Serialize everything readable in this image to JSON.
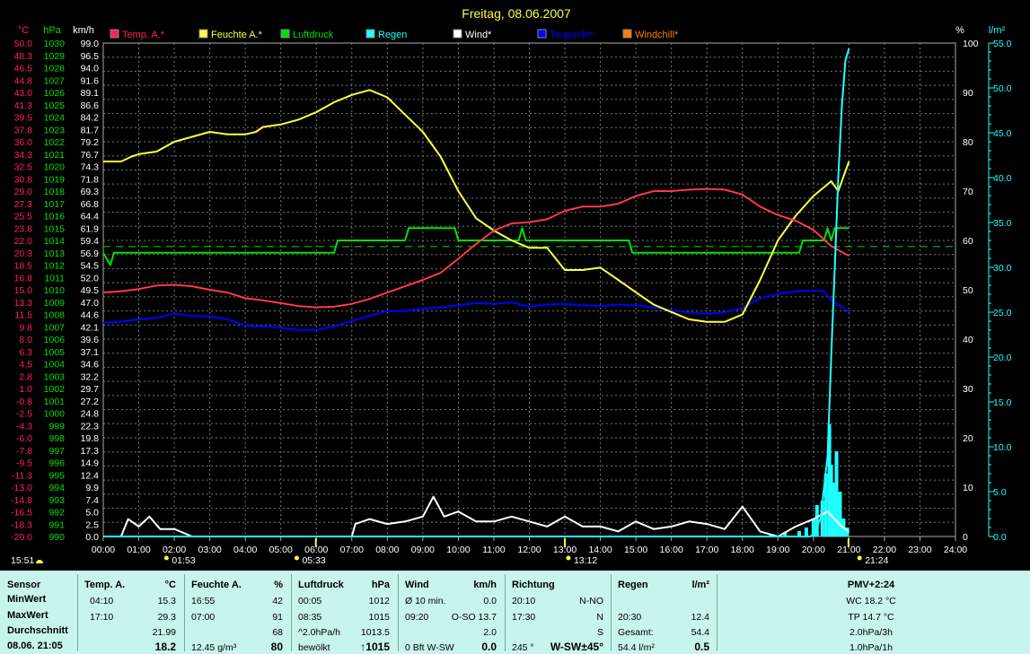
{
  "title": "Freitag, 08.06.2007",
  "colors": {
    "temp": "#ff2060",
    "humidity": "#ffff40",
    "pressure": "#00e000",
    "rain": "#20ffff",
    "wind": "#ffffff",
    "dewpoint": "#0000ff",
    "windchill": "#ff8000",
    "grid": "#777777",
    "axis_temp": "#ff2060",
    "axis_hpa": "#00e000",
    "axis_kmh": "#ffffff",
    "axis_rain": "#20ffff",
    "panel_bg": "#c8f4ee"
  },
  "axis_units": {
    "temp": "°C",
    "hpa": "hPa",
    "kmh": "km/h",
    "pct": "%",
    "rain": "l/m²"
  },
  "legend": [
    "Temp. A.*",
    "Feuchte A.*",
    "Luftdruck",
    "Regen",
    "Wind*",
    "Taupunkt*",
    "Windchill*"
  ],
  "time_labels": [
    "00:00",
    "01:00",
    "02:00",
    "03:00",
    "04:00",
    "05:00",
    "06:00",
    "07:00",
    "08:00",
    "09:00",
    "10:00",
    "11:00",
    "12:00",
    "13:00",
    "14:00",
    "15:00",
    "16:00",
    "17:00",
    "18:00",
    "19:00",
    "20:00",
    "21:00",
    "22:00",
    "23:00",
    "24:00"
  ],
  "events": [
    {
      "label": "01:53",
      "hour": 1.88
    },
    {
      "label": "05:33",
      "hour": 5.55
    },
    {
      "label": "13:12",
      "hour": 13.2
    },
    {
      "label": "21:24",
      "hour": 21.4
    }
  ],
  "current_time": "15:51",
  "chart_data": {
    "type": "line",
    "x_unit": "hour of day",
    "xlim": [
      0,
      24
    ],
    "axes": {
      "temp_c": [
        -20,
        50
      ],
      "pressure_hpa": [
        990,
        1030
      ],
      "wind_kmh": [
        0,
        99
      ],
      "humidity_pct": [
        0,
        100
      ],
      "rain_lm2": [
        0,
        55
      ]
    },
    "series": [
      {
        "name": "Temp. A.*",
        "axis": "temp_c",
        "points": [
          [
            0,
            14.6
          ],
          [
            0.5,
            14.8
          ],
          [
            1,
            15.1
          ],
          [
            1.5,
            15.6
          ],
          [
            2,
            15.7
          ],
          [
            2.5,
            15.5
          ],
          [
            3,
            15
          ],
          [
            3.5,
            14.6
          ],
          [
            4,
            13.8
          ],
          [
            4.5,
            13.5
          ],
          [
            5,
            13.1
          ],
          [
            5.5,
            12.7
          ],
          [
            6,
            12.5
          ],
          [
            6.5,
            12.6
          ],
          [
            7,
            13
          ],
          [
            7.5,
            13.7
          ],
          [
            8,
            14.6
          ],
          [
            8.5,
            15.5
          ],
          [
            9,
            16.4
          ],
          [
            9.5,
            17.4
          ],
          [
            10,
            19.4
          ],
          [
            10.5,
            21.5
          ],
          [
            11,
            23.4
          ],
          [
            11.5,
            24.4
          ],
          [
            12,
            24.6
          ],
          [
            12.5,
            25
          ],
          [
            13,
            26.2
          ],
          [
            13.5,
            26.8
          ],
          [
            14,
            26.8
          ],
          [
            14.5,
            27.2
          ],
          [
            15,
            28.3
          ],
          [
            15.5,
            29
          ],
          [
            16,
            29
          ],
          [
            16.5,
            29.2
          ],
          [
            17,
            29.3
          ],
          [
            17.5,
            29.2
          ],
          [
            18,
            28.5
          ],
          [
            18.5,
            26.8
          ],
          [
            19,
            25.6
          ],
          [
            19.5,
            24.8
          ],
          [
            20,
            23.5
          ],
          [
            20.5,
            21.2
          ],
          [
            21,
            19.8
          ]
        ]
      },
      {
        "name": "Feuchte A.*",
        "axis": "humidity_pct",
        "points": [
          [
            0,
            76
          ],
          [
            0.5,
            76
          ],
          [
            0.8,
            77
          ],
          [
            1,
            77.5
          ],
          [
            1.5,
            78
          ],
          [
            2,
            80
          ],
          [
            2.5,
            81
          ],
          [
            3,
            82
          ],
          [
            3.5,
            81.5
          ],
          [
            4,
            81.5
          ],
          [
            4.3,
            82
          ],
          [
            4.5,
            83
          ],
          [
            5,
            83.5
          ],
          [
            5.5,
            84.5
          ],
          [
            6,
            86
          ],
          [
            6.5,
            88
          ],
          [
            7,
            89.5
          ],
          [
            7.5,
            90.5
          ],
          [
            8,
            89
          ],
          [
            8.5,
            85.5
          ],
          [
            9,
            82
          ],
          [
            9.5,
            77
          ],
          [
            10,
            70
          ],
          [
            10.5,
            64.5
          ],
          [
            11,
            62
          ],
          [
            11.5,
            60
          ],
          [
            12,
            58.5
          ],
          [
            12.5,
            58.5
          ],
          [
            13,
            54
          ],
          [
            13.5,
            54
          ],
          [
            14,
            54.5
          ],
          [
            14.5,
            52
          ],
          [
            15,
            49.5
          ],
          [
            15.5,
            47
          ],
          [
            16,
            45.5
          ],
          [
            16.5,
            44
          ],
          [
            17,
            43.5
          ],
          [
            17.5,
            43.5
          ],
          [
            18,
            45
          ],
          [
            18.5,
            52
          ],
          [
            19,
            60
          ],
          [
            19.5,
            65
          ],
          [
            20,
            69
          ],
          [
            20.5,
            72
          ],
          [
            20.7,
            70
          ],
          [
            21,
            76
          ]
        ]
      },
      {
        "name": "Luftdruck",
        "axis": "pressure_hpa",
        "points": [
          [
            0,
            1013
          ],
          [
            0.2,
            1012
          ],
          [
            0.3,
            1013
          ],
          [
            1,
            1013
          ],
          [
            2,
            1013
          ],
          [
            3,
            1013
          ],
          [
            4,
            1013
          ],
          [
            5,
            1013
          ],
          [
            6,
            1013
          ],
          [
            6.5,
            1013
          ],
          [
            6.6,
            1014
          ],
          [
            7,
            1014
          ],
          [
            8,
            1014
          ],
          [
            8.5,
            1014
          ],
          [
            8.6,
            1015
          ],
          [
            9,
            1015
          ],
          [
            9.9,
            1015
          ],
          [
            10,
            1014
          ],
          [
            11,
            1014
          ],
          [
            11.7,
            1014
          ],
          [
            11.8,
            1015
          ],
          [
            11.9,
            1014
          ],
          [
            12,
            1014
          ],
          [
            13,
            1014
          ],
          [
            14,
            1014
          ],
          [
            14.8,
            1014
          ],
          [
            14.9,
            1013
          ],
          [
            16,
            1013
          ],
          [
            17,
            1013
          ],
          [
            18,
            1013
          ],
          [
            19,
            1013
          ],
          [
            19.6,
            1013
          ],
          [
            19.7,
            1014
          ],
          [
            20.3,
            1014
          ],
          [
            20.4,
            1015
          ],
          [
            20.5,
            1014
          ],
          [
            20.6,
            1015
          ],
          [
            21,
            1015
          ]
        ]
      },
      {
        "name": "Wind*",
        "axis": "wind_kmh",
        "points": [
          [
            0,
            0
          ],
          [
            0.5,
            0
          ],
          [
            0.7,
            3.5
          ],
          [
            1,
            2
          ],
          [
            1.3,
            4
          ],
          [
            1.6,
            1.5
          ],
          [
            2,
            1.5
          ],
          [
            2.5,
            0
          ],
          [
            3,
            0
          ],
          [
            7,
            0
          ],
          [
            7.1,
            2.5
          ],
          [
            7.5,
            3.5
          ],
          [
            8,
            2.5
          ],
          [
            8.5,
            3
          ],
          [
            9,
            4
          ],
          [
            9.3,
            8
          ],
          [
            9.6,
            4
          ],
          [
            10,
            5
          ],
          [
            10.5,
            3
          ],
          [
            11,
            3
          ],
          [
            11.5,
            4
          ],
          [
            12,
            3
          ],
          [
            12.5,
            2
          ],
          [
            13,
            4
          ],
          [
            13.5,
            2
          ],
          [
            14,
            2
          ],
          [
            14.5,
            1
          ],
          [
            15,
            3
          ],
          [
            15.5,
            1.5
          ],
          [
            16,
            2
          ],
          [
            16.5,
            3
          ],
          [
            17,
            2.5
          ],
          [
            17.5,
            1.5
          ],
          [
            18,
            6
          ],
          [
            18.5,
            1
          ],
          [
            19,
            0
          ],
          [
            19.5,
            2
          ],
          [
            20,
            3.5
          ],
          [
            20.4,
            5
          ],
          [
            20.8,
            2
          ],
          [
            21,
            1
          ]
        ]
      },
      {
        "name": "Taupunkt*",
        "axis": "temp_c",
        "points": [
          [
            0,
            10.3
          ],
          [
            0.5,
            10.5
          ],
          [
            1,
            10.8
          ],
          [
            1.5,
            11
          ],
          [
            2,
            11.6
          ],
          [
            2.5,
            11.3
          ],
          [
            3,
            11.2
          ],
          [
            3.5,
            10.8
          ],
          [
            4,
            9.9
          ],
          [
            4.5,
            9.8
          ],
          [
            5,
            9.6
          ],
          [
            5.5,
            9.3
          ],
          [
            6,
            9.3
          ],
          [
            6.5,
            9.8
          ],
          [
            7,
            10.6
          ],
          [
            7.5,
            11.3
          ],
          [
            8,
            12
          ],
          [
            8.5,
            12
          ],
          [
            9,
            12.3
          ],
          [
            9.5,
            12.5
          ],
          [
            10,
            12.8
          ],
          [
            10.5,
            13.1
          ],
          [
            11,
            13
          ],
          [
            11.5,
            13.2
          ],
          [
            12,
            12.6
          ],
          [
            12.5,
            12.9
          ],
          [
            13,
            13
          ],
          [
            13.5,
            12.8
          ],
          [
            14,
            12.7
          ],
          [
            14.5,
            12.9
          ],
          [
            15,
            12.8
          ],
          [
            15.5,
            12.5
          ],
          [
            16,
            12.1
          ],
          [
            16.5,
            11.8
          ],
          [
            17,
            11.6
          ],
          [
            17.5,
            11.8
          ],
          [
            18,
            12.4
          ],
          [
            18.5,
            13.8
          ],
          [
            19,
            14.4
          ],
          [
            19.5,
            14.8
          ],
          [
            20,
            14.9
          ],
          [
            20.3,
            14.8
          ],
          [
            20.5,
            13.5
          ],
          [
            21,
            11.9
          ]
        ]
      },
      {
        "name": "Regen",
        "axis": "rain_lm2",
        "points": [
          [
            0,
            0
          ],
          [
            19.9,
            0
          ],
          [
            20,
            0.2
          ],
          [
            20.2,
            2
          ],
          [
            20.4,
            9
          ],
          [
            20.5,
            20
          ],
          [
            20.6,
            30
          ],
          [
            20.7,
            40
          ],
          [
            20.8,
            48
          ],
          [
            20.9,
            53
          ],
          [
            21,
            54.4
          ]
        ]
      }
    ],
    "rain_bars": [
      [
        18.8,
        0.3
      ],
      [
        19.2,
        0.5
      ],
      [
        19.6,
        0.6
      ],
      [
        19.8,
        1
      ],
      [
        20.0,
        2
      ],
      [
        20.1,
        3.5
      ],
      [
        20.25,
        4
      ],
      [
        20.35,
        7
      ],
      [
        20.45,
        12.5
      ],
      [
        20.5,
        8
      ],
      [
        20.55,
        6
      ],
      [
        20.65,
        9.5
      ],
      [
        20.75,
        5
      ],
      [
        20.85,
        2
      ],
      [
        20.95,
        1
      ]
    ]
  },
  "panel": {
    "sensor": {
      "header": "Sensor",
      "rows": [
        "MinWert",
        "MaxWert",
        "Durchschnitt",
        "08.06. 21:05"
      ]
    },
    "temp": {
      "header": "Temp. A.",
      "unit": "°C",
      "rows": [
        [
          "04:10",
          "15.3"
        ],
        [
          "17:10",
          "29.3"
        ],
        [
          "",
          "21.99"
        ],
        [
          "",
          "18.2"
        ]
      ]
    },
    "humidity": {
      "header": "Feuchte A.",
      "unit": "%",
      "rows": [
        [
          "16:55",
          "42"
        ],
        [
          "07:00",
          "91"
        ],
        [
          "",
          "68"
        ],
        [
          "12.45 g/m³",
          "80"
        ]
      ]
    },
    "pressure": {
      "header": "Luftdruck",
      "unit": "hPa",
      "rows": [
        [
          "00:05",
          "1012"
        ],
        [
          "08:35",
          "1015"
        ],
        [
          "^2.0hPa/h",
          "1013.5"
        ],
        [
          "bewölkt",
          "↑1015"
        ]
      ]
    },
    "wind": {
      "header": "Wind",
      "unit": "km/h",
      "rows": [
        [
          "Ø 10 min.",
          "0.0"
        ],
        [
          "09:20",
          "O-SO 13.7"
        ],
        [
          "",
          "2.0"
        ],
        [
          "0 Bft W-SW",
          "0.0"
        ]
      ]
    },
    "direction": {
      "header": "Richtung",
      "rows": [
        [
          "20:10",
          "N-NO"
        ],
        [
          "17:30",
          "N"
        ],
        [
          "",
          "S"
        ],
        [
          "245 °",
          "W-SW±45°"
        ]
      ]
    },
    "rain": {
      "header": "Regen",
      "unit": "l/m²",
      "rows": [
        [
          "",
          ""
        ],
        [
          "20:30",
          "12.4"
        ],
        [
          "Gesamt:",
          "54.4"
        ],
        [
          "54.4 l/m²",
          "0.5"
        ]
      ]
    },
    "pmv": {
      "header": "PMV+2:24",
      "rows": [
        "WC 18.2 °C",
        "TP 14.7 °C",
        "2.0hPa/3h",
        "1.0hPa/1h"
      ]
    }
  }
}
